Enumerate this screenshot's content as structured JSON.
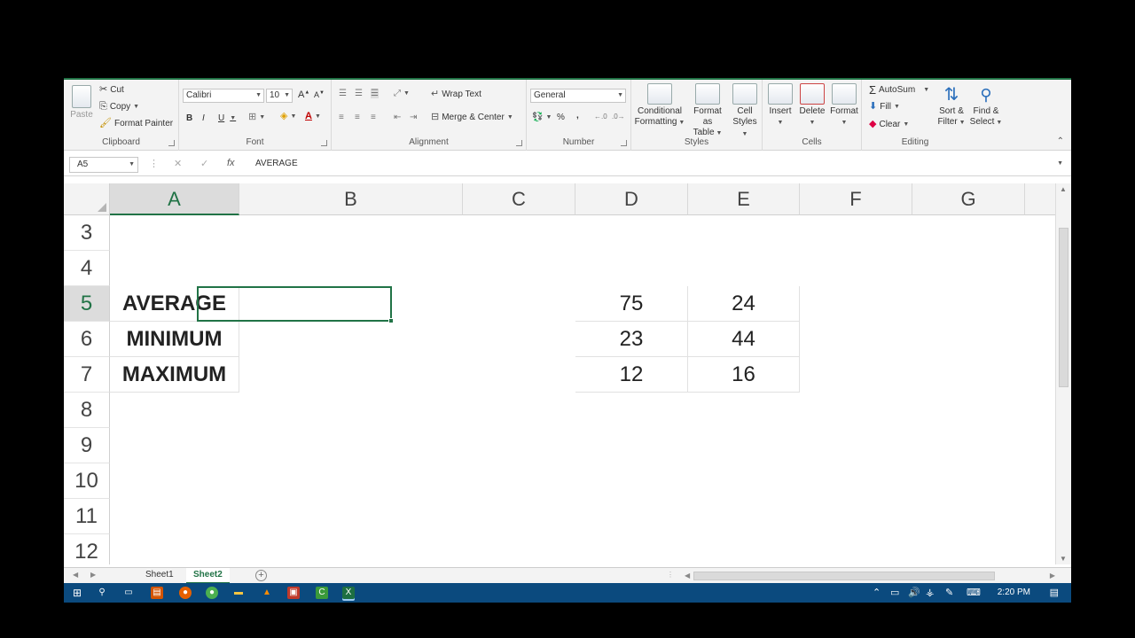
{
  "ribbon": {
    "clipboard": {
      "paste": "Paste",
      "cut": "Cut",
      "copy": "Copy",
      "format_painter": "Format Painter",
      "label": "Clipboard"
    },
    "font": {
      "name": "Calibri",
      "size": "10",
      "bold": "B",
      "italic": "I",
      "underline": "U",
      "label": "Font"
    },
    "alignment": {
      "wrap_text": "Wrap Text",
      "merge_center": "Merge & Center",
      "label": "Alignment"
    },
    "number": {
      "format": "General",
      "percent": "%",
      "comma": ",",
      "label": "Number"
    },
    "styles": {
      "conditional_1": "Conditional",
      "conditional_2": "Formatting",
      "format_table_1": "Format as",
      "format_table_2": "Table",
      "cell_styles_1": "Cell",
      "cell_styles_2": "Styles",
      "label": "Styles"
    },
    "cells": {
      "insert": "Insert",
      "delete": "Delete",
      "format": "Format",
      "label": "Cells"
    },
    "editing": {
      "autosum": "AutoSum",
      "fill": "Fill",
      "clear": "Clear",
      "sort_1": "Sort &",
      "sort_2": "Filter",
      "find_1": "Find &",
      "find_2": "Select",
      "label": "Editing"
    }
  },
  "formula_bar": {
    "name_box": "A5",
    "fx": "fx",
    "content": "AVERAGE"
  },
  "columns": [
    "A",
    "B",
    "C",
    "D",
    "E",
    "F",
    "G"
  ],
  "rows": [
    "3",
    "4",
    "5",
    "6",
    "7",
    "8",
    "9",
    "10",
    "11",
    "12"
  ],
  "cells": {
    "A5": "AVERAGE",
    "A6": "MINIMUM",
    "A7": "MAXIMUM",
    "D5": "75",
    "D6": "23",
    "D7": "12",
    "E5": "24",
    "E6": "44",
    "E7": "16"
  },
  "selected_cell": "A5",
  "sheets": [
    "Sheet1",
    "Sheet2"
  ],
  "active_sheet": "Sheet2",
  "taskbar": {
    "clock": "2:20 PM"
  },
  "colors": {
    "accent": "#217346",
    "taskbar": "#0b4a7e"
  }
}
